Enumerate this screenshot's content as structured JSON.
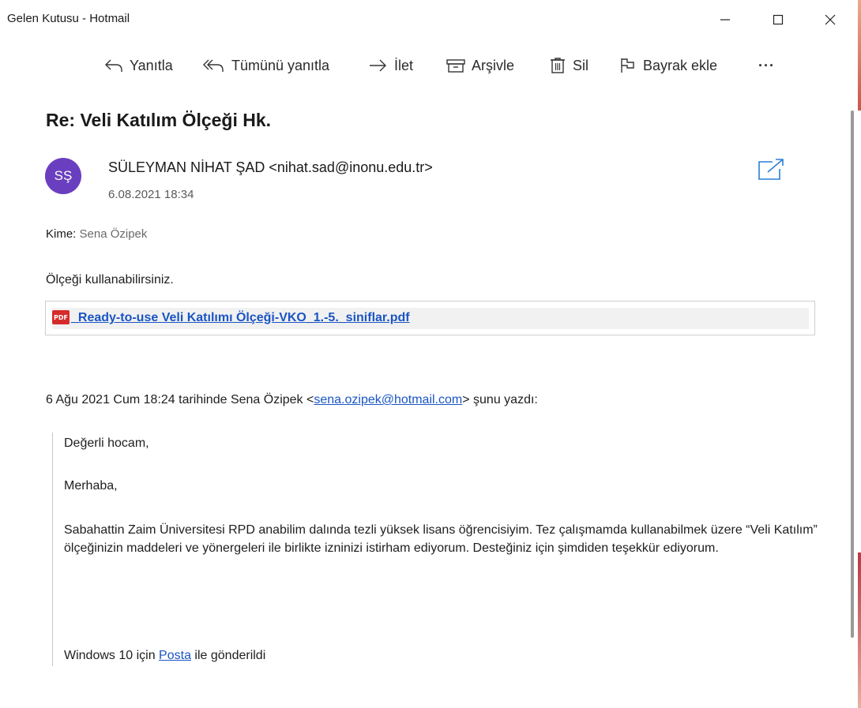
{
  "window": {
    "title": "Gelen Kutusu - Hotmail"
  },
  "toolbar": {
    "reply": "Yanıtla",
    "reply_all": "Tümünü yanıtla",
    "forward": "İlet",
    "archive": "Arşivle",
    "delete": "Sil",
    "flag": "Bayrak ekle",
    "more": "···"
  },
  "message": {
    "subject": "Re: Veli Katılım Ölçeği Hk.",
    "avatar_initials": "SŞ",
    "avatar_color": "#6a3fbf",
    "sender": "SÜLEYMAN NİHAT ŞAD <nihat.sad@inonu.edu.tr>",
    "date": "6.08.2021 18:34",
    "to_label": "Kime:",
    "to_value": "Sena Özipek",
    "body": "Ölçeği kullanabilirsiniz.",
    "attachment": {
      "icon_text": "PDF",
      "name": "_Ready-to-use Veli Katılımı Ölçeği-VKO_1.-5._siniflar.pdf"
    }
  },
  "quote": {
    "header_prefix": "6 Ağu 2021 Cum 18:24 tarihinde Sena Özipek <",
    "header_email": "sena.ozipek@hotmail.com",
    "header_suffix": "> şunu yazdı:",
    "greeting": "Değerli hocam,",
    "hello": "Merhaba,",
    "paragraph": "Sabahattin Zaim Üniversitesi RPD anabilim dalında tezli yüksek lisans öğrencisiyim. Tez çalışmamda kullanabilmek üzere “Veli Katılım” ölçeğinizin maddeleri ve yönergeleri ile birlikte izninizi istirham ediyorum. Desteğiniz için şimdiden teşekkür ediyorum.",
    "signature_prefix": "Windows 10 için ",
    "signature_link": "Posta",
    "signature_suffix": " ile gönderildi"
  },
  "colors": {
    "accent": "#1a55c4",
    "icon_blue": "#2a7fd6",
    "pdf_red": "#d62b2b"
  }
}
